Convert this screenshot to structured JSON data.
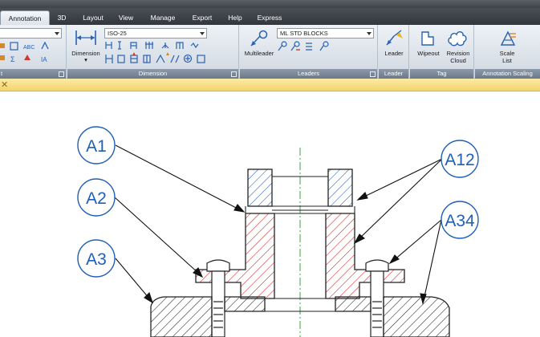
{
  "tabs": [
    "Annotation",
    "3D",
    "Layout",
    "View",
    "Manage",
    "Export",
    "Help",
    "Express"
  ],
  "ribbon": {
    "text_panel": {
      "title": "t"
    },
    "dimension_panel": {
      "title": "Dimension",
      "style_value": "ISO-25",
      "big_button_label": "Dimension"
    },
    "leaders_panel": {
      "title": "Leaders",
      "style_value": "ML STD BLOCKS",
      "big_button_label": "Multileader"
    },
    "leader_panel": {
      "title": "Leader",
      "button_label": "Leader"
    },
    "tag_panel": {
      "title": "Tag",
      "wipeout_label": "Wipeout",
      "revision_label_1": "Revision",
      "revision_label_2": "Cloud"
    },
    "scaling_panel": {
      "title": "Annotation Scaling",
      "scale_label_1": "Scale",
      "scale_label_2": "List"
    }
  },
  "drawing": {
    "balloons": [
      "A1",
      "A2",
      "A3",
      "A12",
      "A34"
    ]
  },
  "colors": {
    "balloon_blue": "#1f5fb5",
    "section_red": "#d21f1f",
    "section_blue": "#1f5fb5",
    "centerline_green": "#3aa63a"
  }
}
